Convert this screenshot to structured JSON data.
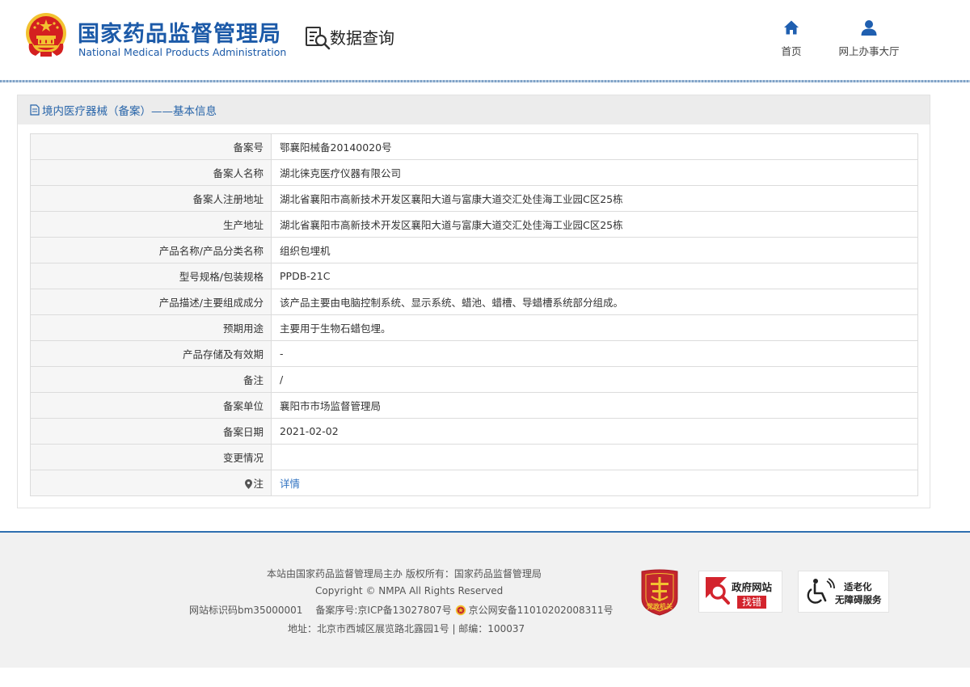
{
  "header": {
    "org_name_cn": "国家药品监督管理局",
    "org_name_en": "National Medical Products Administration",
    "section_title": "数据查询",
    "nav": [
      {
        "label": "首页",
        "icon": "home-icon"
      },
      {
        "label": "网上办事大厅",
        "icon": "user-icon"
      }
    ]
  },
  "panel": {
    "title": "境内医疗器械（备案）——基本信息",
    "rows": [
      {
        "label": "备案号",
        "value": "鄂襄阳械备20140020号"
      },
      {
        "label": "备案人名称",
        "value": "湖北徕克医疗仪器有限公司"
      },
      {
        "label": "备案人注册地址",
        "value": "湖北省襄阳市高新技术开发区襄阳大道与富康大道交汇处佳海工业园C区25栋"
      },
      {
        "label": "生产地址",
        "value": "湖北省襄阳市高新技术开发区襄阳大道与富康大道交汇处佳海工业园C区25栋"
      },
      {
        "label": "产品名称/产品分类名称",
        "value": "组织包埋机"
      },
      {
        "label": "型号规格/包装规格",
        "value": "PPDB-21C"
      },
      {
        "label": "产品描述/主要组成成分",
        "value": "该产品主要由电脑控制系统、显示系统、蜡池、蜡槽、导蜡槽系统部分组成。"
      },
      {
        "label": "预期用途",
        "value": "主要用于生物石蜡包埋。"
      },
      {
        "label": "产品存储及有效期",
        "value": "-"
      },
      {
        "label": "备注",
        "value": "/"
      },
      {
        "label": "备案单位",
        "value": "襄阳市市场监督管理局"
      },
      {
        "label": "备案日期",
        "value": "2021-02-02"
      },
      {
        "label": "变更情况",
        "value": ""
      }
    ],
    "note_label": "注",
    "note_link": "详情"
  },
  "footer": {
    "line1": "本站由国家药品监督管理局主办 版权所有：国家药品监督管理局",
    "line2": "Copyright © NMPA All Rights Reserved",
    "site_id": "网站标识码bm35000001",
    "icp": "备案序号:京ICP备13027807号",
    "police": "京公网安备11010202008311号",
    "address": "地址：北京市西城区展览路北露园1号 | 邮编：100037",
    "badge_party": "党政机关",
    "badge_error_title": "政府网站",
    "badge_error_sub": "找错",
    "badge_access_line1": "适老化",
    "badge_access_line2": "无障碍服务"
  },
  "colors": {
    "brand_blue": "#1c5aa8",
    "link_blue": "#2f72c1",
    "panel_header_bg": "#ececec",
    "label_bg": "#f6f6f6",
    "footer_bg": "#f1f1f1",
    "emblem_red": "#d42020",
    "emblem_gold": "#f2c230"
  }
}
